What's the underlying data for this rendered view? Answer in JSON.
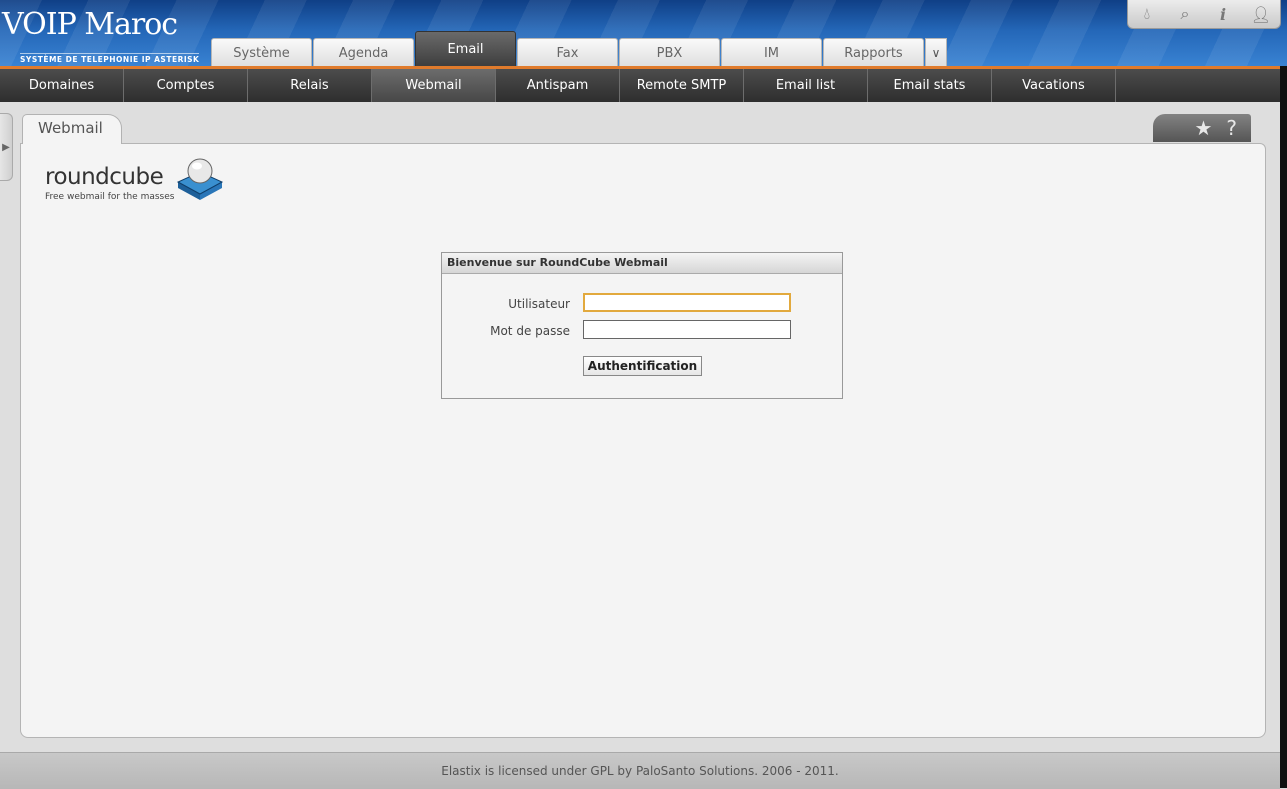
{
  "header": {
    "brand": "VOIP Maroc",
    "tagline": "SYSTÈME DE TELEPHONIE IP ASTERISK",
    "colors": {
      "header_blue": "#2467b8",
      "accent_orange": "#e07b2c"
    },
    "icons": [
      "drop-icon",
      "search-icon",
      "info-icon",
      "user-icon"
    ]
  },
  "main_tabs": [
    {
      "label": "Système",
      "active": false
    },
    {
      "label": "Agenda",
      "active": false
    },
    {
      "label": "Email",
      "active": true
    },
    {
      "label": "Fax",
      "active": false
    },
    {
      "label": "PBX",
      "active": false
    },
    {
      "label": "IM",
      "active": false
    },
    {
      "label": "Rapports",
      "active": false
    }
  ],
  "sub_tabs": [
    {
      "label": "Domaines",
      "active": false
    },
    {
      "label": "Comptes",
      "active": false
    },
    {
      "label": "Relais",
      "active": false
    },
    {
      "label": "Webmail",
      "active": true
    },
    {
      "label": "Antispam",
      "active": false
    },
    {
      "label": "Remote SMTP",
      "active": false
    },
    {
      "label": "Email list",
      "active": false
    },
    {
      "label": "Email stats",
      "active": false
    },
    {
      "label": "Vacations",
      "active": false
    }
  ],
  "page": {
    "tab_title": "Webmail",
    "tab_icons": [
      "star-icon",
      "help-icon"
    ]
  },
  "roundcube": {
    "logo_word": "roundcube",
    "logo_tag": "Free webmail for the masses"
  },
  "login": {
    "title": "Bienvenue sur RoundCube Webmail",
    "user_label": "Utilisateur",
    "user_value": "",
    "password_label": "Mot de passe",
    "password_value": "",
    "submit_label": "Authentification"
  },
  "footer": {
    "text": "Elastix is licensed under GPL by PaloSanto Solutions. 2006 - 2011."
  }
}
